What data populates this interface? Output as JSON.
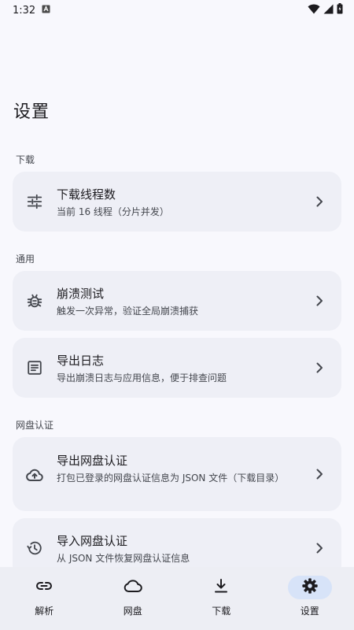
{
  "status_bar": {
    "time": "1:32"
  },
  "page": {
    "title": "设置"
  },
  "sections": {
    "download": {
      "header": "下载",
      "thread_count": {
        "title": "下载线程数",
        "subtitle": "当前 16 线程（分片并发）"
      }
    },
    "general": {
      "header": "通用",
      "crash_test": {
        "title": "崩溃测试",
        "subtitle": "触发一次异常，验证全局崩溃捕获"
      },
      "export_logs": {
        "title": "导出日志",
        "subtitle": "导出崩溃日志与应用信息，便于排查问题"
      }
    },
    "auth": {
      "header": "网盘认证",
      "export_auth": {
        "title": "导出网盘认证",
        "subtitle": "打包已登录的网盘认证信息为 JSON 文件（下载目录）"
      },
      "import_auth": {
        "title": "导入网盘认证",
        "subtitle": "从 JSON 文件恢复网盘认证信息"
      }
    }
  },
  "bottom_nav": {
    "items": [
      {
        "label": "解析",
        "icon": "link-icon",
        "active": false
      },
      {
        "label": "网盘",
        "icon": "cloud-icon",
        "active": false
      },
      {
        "label": "下载",
        "icon": "download-icon",
        "active": false
      },
      {
        "label": "设置",
        "icon": "gear-icon",
        "active": true
      }
    ]
  },
  "colors": {
    "background": "#f8f8fd",
    "card": "#eeeff6",
    "nav_background": "#edeef4",
    "active_pill": "#d7e3f8",
    "text_primary": "#1c1b1f",
    "text_secondary": "#44474e"
  }
}
